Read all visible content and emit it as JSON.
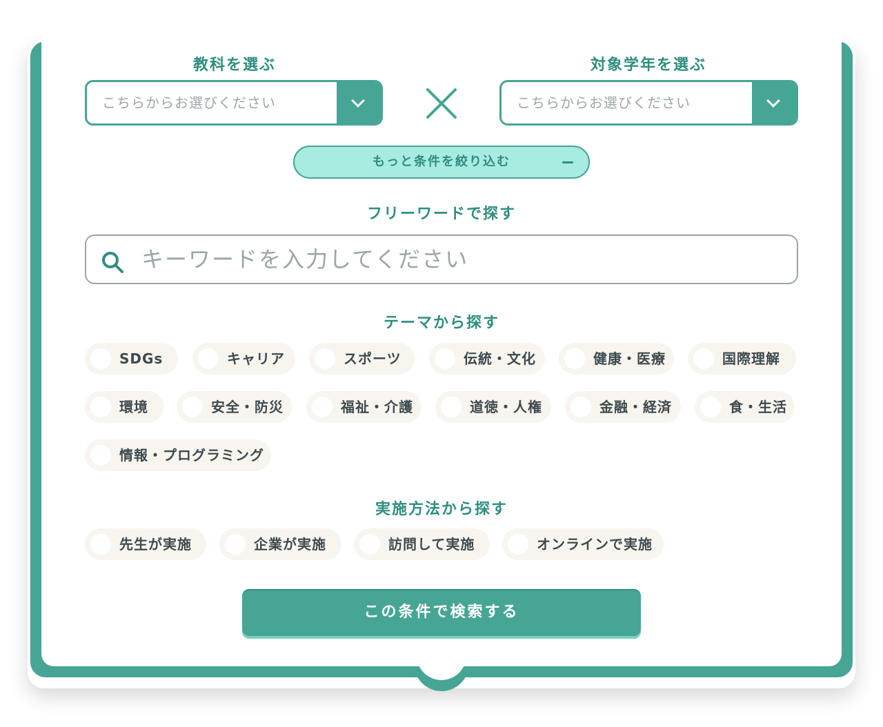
{
  "colors": {
    "accent": "#46a595",
    "heading": "#2f8e80",
    "pill_bg": "#a8ebe0",
    "chip_bg": "#f8f5ef",
    "placeholder": "#9aa6a8"
  },
  "subject": {
    "heading": "教科を選ぶ",
    "placeholder": "こちらからお選びください"
  },
  "grade": {
    "heading": "対象学年を選ぶ",
    "placeholder": "こちらからお選びください"
  },
  "narrow": {
    "label": "もっと条件を絞り込む"
  },
  "freeword": {
    "heading": "フリーワードで探す",
    "placeholder": "キーワードを入力してください"
  },
  "theme": {
    "heading": "テーマから探す",
    "items": [
      "SDGs",
      "キャリア",
      "スポーツ",
      "伝統・文化",
      "健康・医療",
      "国際理解",
      "環境",
      "安全・防災",
      "福祉・介護",
      "道徳・人権",
      "金融・経済",
      "食・生活",
      "情報・プログラミング"
    ]
  },
  "method": {
    "heading": "実施方法から探す",
    "items": [
      "先生が実施",
      "企業が実施",
      "訪問して実施",
      "オンラインで実施"
    ]
  },
  "submit": {
    "label": "この条件で検索する"
  }
}
